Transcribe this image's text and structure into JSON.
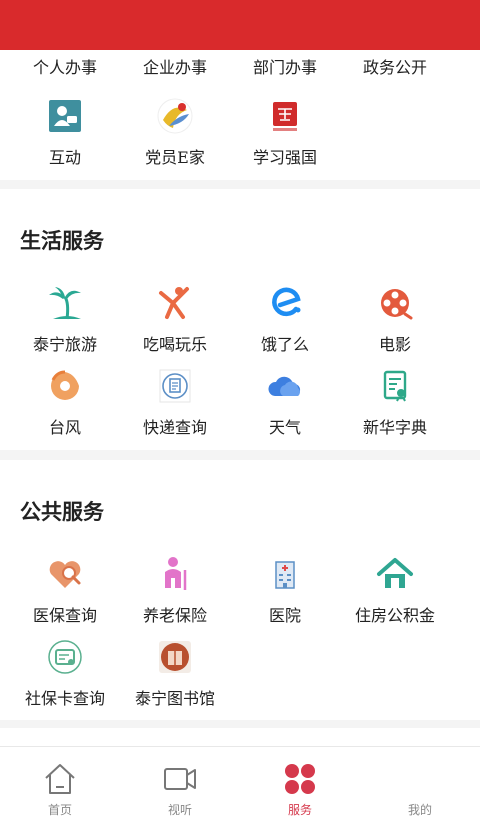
{
  "gov": {
    "top_labels": [
      "个人办事",
      "企业办事",
      "部门办事",
      "政务公开"
    ],
    "tiles": [
      {
        "label": "互动",
        "icon": "chat-user-icon"
      },
      {
        "label": "党员E家",
        "icon": "party-member-icon"
      },
      {
        "label": "学习强国",
        "icon": "xuexi-qiangguo-icon"
      }
    ]
  },
  "life": {
    "title": "生活服务",
    "tiles": [
      {
        "label": "泰宁旅游",
        "icon": "palm-tree-icon"
      },
      {
        "label": "吃喝玩乐",
        "icon": "person-cheer-icon"
      },
      {
        "label": "饿了么",
        "icon": "eleme-icon"
      },
      {
        "label": "电影",
        "icon": "film-reel-icon"
      },
      {
        "label": "台风",
        "icon": "typhoon-icon"
      },
      {
        "label": "快递查询",
        "icon": "parcel-icon"
      },
      {
        "label": "天气",
        "icon": "cloud-weather-icon"
      },
      {
        "label": "新华字典",
        "icon": "dictionary-icon"
      }
    ]
  },
  "pub": {
    "title": "公共服务",
    "tiles": [
      {
        "label": "医保查询",
        "icon": "heart-search-icon"
      },
      {
        "label": "养老保险",
        "icon": "elderly-icon"
      },
      {
        "label": "医院",
        "icon": "hospital-icon"
      },
      {
        "label": "住房公积金",
        "icon": "house-icon"
      },
      {
        "label": "社保卡查询",
        "icon": "social-card-icon"
      },
      {
        "label": "泰宁图书馆",
        "icon": "library-icon"
      }
    ]
  },
  "tabs": [
    {
      "label": "首页",
      "icon": "home-icon"
    },
    {
      "label": "视听",
      "icon": "video-camera-icon"
    },
    {
      "label": "服务",
      "icon": "services-grid-icon"
    },
    {
      "label": "我的",
      "icon": "profile-icon"
    }
  ],
  "colors": {
    "header": "#d92a2c",
    "active_tab": "#d5394c"
  }
}
